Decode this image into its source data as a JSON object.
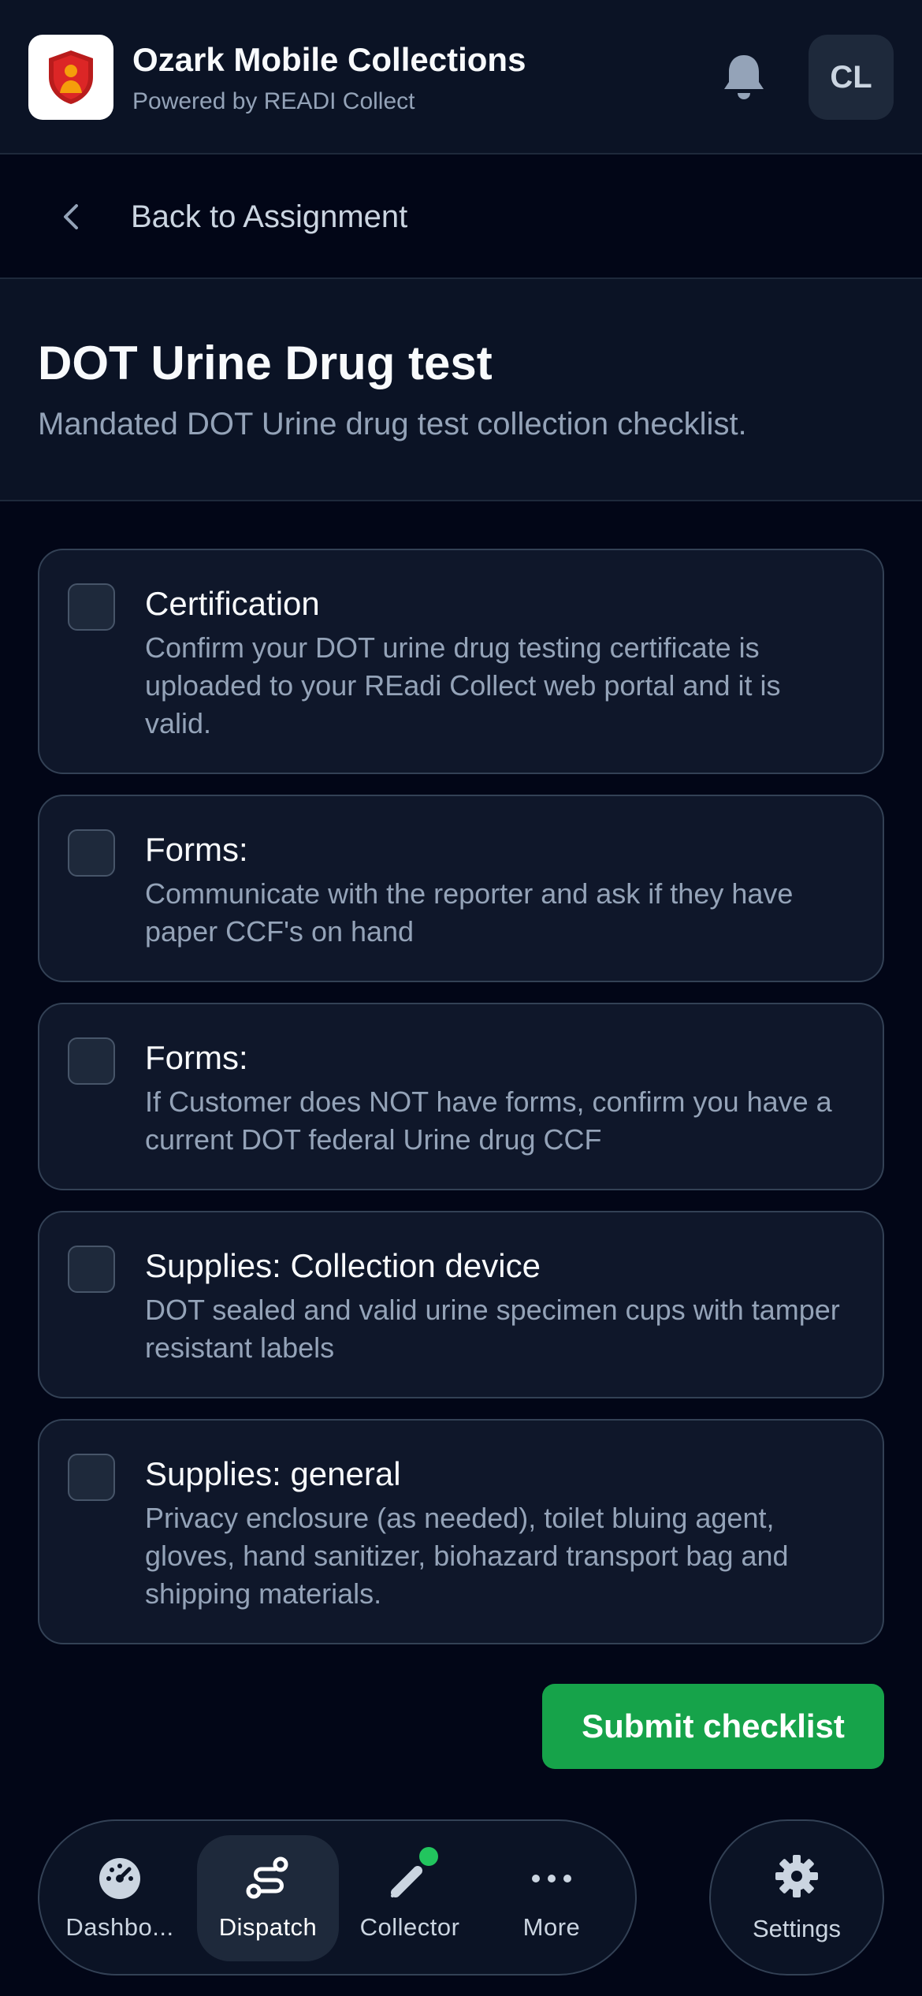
{
  "header": {
    "title": "Ozark Mobile Collections",
    "subtitle": "Powered by READI Collect",
    "avatar_initials": "CL",
    "logo_icon": "shield-person-logo",
    "bell_icon": "bell-icon"
  },
  "back": {
    "label": "Back to Assignment"
  },
  "page": {
    "title": "DOT Urine Drug test",
    "description": "Mandated DOT Urine drug test collection checklist."
  },
  "checklist": [
    {
      "title": "Certification",
      "description": "Confirm your DOT urine drug testing certificate is uploaded to your REadi Collect web portal and it is valid.",
      "checked": false
    },
    {
      "title": "Forms:",
      "description": "Communicate with the reporter and ask if they have paper CCF's on hand",
      "checked": false
    },
    {
      "title": "Forms:",
      "description": "If Customer does NOT have forms, confirm you have a current DOT federal Urine drug CCF",
      "checked": false
    },
    {
      "title": "Supplies: Collection device",
      "description": "DOT sealed and valid urine specimen cups with tamper resistant labels",
      "checked": false
    },
    {
      "title": "Supplies: general",
      "description": "Privacy enclosure (as needed), toilet bluing agent, gloves, hand sanitizer, biohazard transport bag and shipping materials.",
      "checked": false
    }
  ],
  "submit_label": "Submit checklist",
  "nav": {
    "items": [
      {
        "label": "Dashbo...",
        "icon": "gauge-icon",
        "active": false
      },
      {
        "label": "Dispatch",
        "icon": "route-icon",
        "active": true
      },
      {
        "label": "Collector",
        "icon": "syringe-icon",
        "active": false,
        "status_dot": true
      },
      {
        "label": "More",
        "icon": "ellipsis-icon",
        "active": false
      }
    ],
    "settings": {
      "label": "Settings",
      "icon": "gear-icon"
    }
  },
  "colors": {
    "background": "#020617",
    "surface": "#0b1325",
    "card": "#0f172a",
    "accent_green": "#16a34a",
    "status_dot": "#22c55e",
    "logo_red": "#b91c1c"
  }
}
